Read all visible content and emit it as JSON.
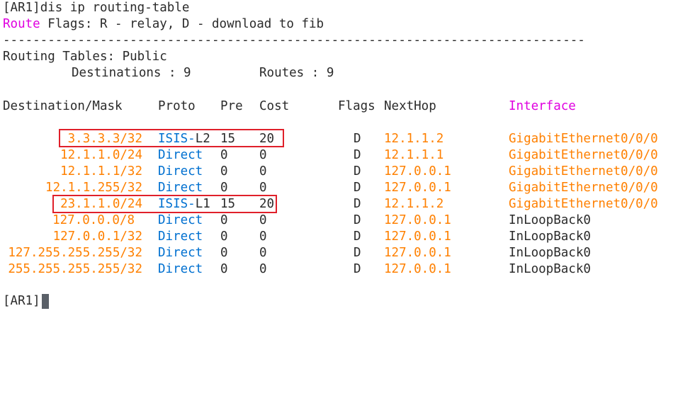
{
  "command_line": {
    "prompt": "[AR1]",
    "command": "dis ip routing-table"
  },
  "route_flags": {
    "keyword": "Route",
    "text": " Flags: R - relay, D - download to fib"
  },
  "separator": "------------------------------------------------------------------------------",
  "routing_tables_label": "Routing Tables: Public",
  "summary": {
    "destinations_label": "Destinations : 9",
    "routes_label": "Routes : 9"
  },
  "table": {
    "headers": {
      "destination": "Destination/Mask",
      "proto": "Proto",
      "pre": "Pre",
      "cost": "Cost",
      "flags": "Flags",
      "nexthop": "NextHop",
      "interface": "Interface"
    },
    "rows": [
      {
        "destination": "3.3.3.3/32",
        "proto": "ISIS-",
        "proto_suffix": "L2",
        "pre": "15",
        "cost": "20",
        "flags": "D",
        "nexthop": "12.1.1.2",
        "interface": "GigabitEthernet0/0/0"
      },
      {
        "destination": "12.1.1.0/24",
        "proto": "Direct",
        "proto_suffix": "",
        "pre": "0",
        "cost": "0",
        "flags": "D",
        "nexthop": "12.1.1.1",
        "interface": "GigabitEthernet0/0/0"
      },
      {
        "destination": "12.1.1.1/32",
        "proto": "Direct",
        "proto_suffix": "",
        "pre": "0",
        "cost": "0",
        "flags": "D",
        "nexthop": "127.0.0.1",
        "interface": "GigabitEthernet0/0/0"
      },
      {
        "destination": "12.1.1.255/32",
        "proto": "Direct",
        "proto_suffix": "",
        "pre": "0",
        "cost": "0",
        "flags": "D",
        "nexthop": "127.0.0.1",
        "interface": "GigabitEthernet0/0/0"
      },
      {
        "destination": "23.1.1.0/24",
        "proto": "ISIS-",
        "proto_suffix": "L1",
        "pre": "15",
        "cost": "20",
        "flags": "D",
        "nexthop": "12.1.1.2",
        "interface": "GigabitEthernet0/0/0"
      },
      {
        "destination": "127.0.0.0/8",
        "proto": "Direct",
        "proto_suffix": "",
        "pre": "0",
        "cost": "0",
        "flags": "D",
        "nexthop": "127.0.0.1",
        "interface": "InLoopBack0"
      },
      {
        "destination": "127.0.0.1/32",
        "proto": "Direct",
        "proto_suffix": "",
        "pre": "0",
        "cost": "0",
        "flags": "D",
        "nexthop": "127.0.0.1",
        "interface": "InLoopBack0"
      },
      {
        "destination": "127.255.255.255/32",
        "proto": "Direct",
        "proto_suffix": "",
        "pre": "0",
        "cost": "0",
        "flags": "D",
        "nexthop": "127.0.0.1",
        "interface": "InLoopBack0"
      },
      {
        "destination": "255.255.255.255/32",
        "proto": "Direct",
        "proto_suffix": "",
        "pre": "0",
        "cost": "0",
        "flags": "D",
        "nexthop": "127.0.0.1",
        "interface": "InLoopBack0"
      }
    ]
  },
  "final_prompt": "[AR1]",
  "colors": {
    "keyword_magenta": "#e000e0",
    "ip_orange": "#ff8000",
    "proto_blue": "#0070d0",
    "highlight_red": "#e0202a",
    "text_dark": "#2b2b2b"
  }
}
